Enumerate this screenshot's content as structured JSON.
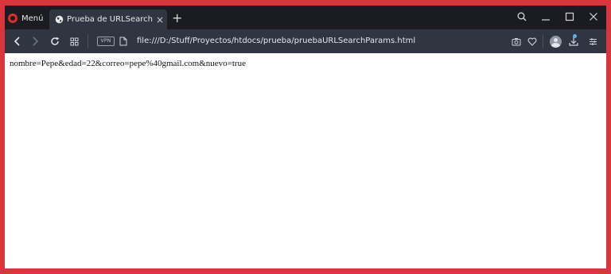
{
  "tabbar": {
    "menu_label": "Menú",
    "tab_title": "Prueba de URLSearchParams",
    "tab_close_glyph": "×",
    "new_tab_glyph": "+",
    "icons": [
      "opera-logo-icon",
      "globe-icon",
      "close-icon",
      "plus-icon",
      "search-icon",
      "minimize-icon",
      "maximize-icon",
      "window-close-icon"
    ]
  },
  "addressbar": {
    "vpn_label": "VPN",
    "url": "file:///D:/Stuff/Proyectos/htdocs/prueba/pruebaURLSearchParams.html",
    "icons": [
      "back-icon",
      "forward-icon",
      "reload-icon",
      "tabs-grid-icon",
      "file-icon",
      "camera-icon",
      "heart-icon",
      "avatar-icon",
      "download-icon",
      "settings-sliders-icon"
    ]
  },
  "page": {
    "output_text": "nombre=Pepe&edad=22&correo=pepe%40gmail.com&nuevo=true"
  },
  "colors": {
    "frame": "#d9353d",
    "tabbar_bg": "#1b1c21",
    "toolbar_bg": "#2f3541",
    "opera_red": "#e22a35",
    "download_badge": "#5bb2f2"
  }
}
